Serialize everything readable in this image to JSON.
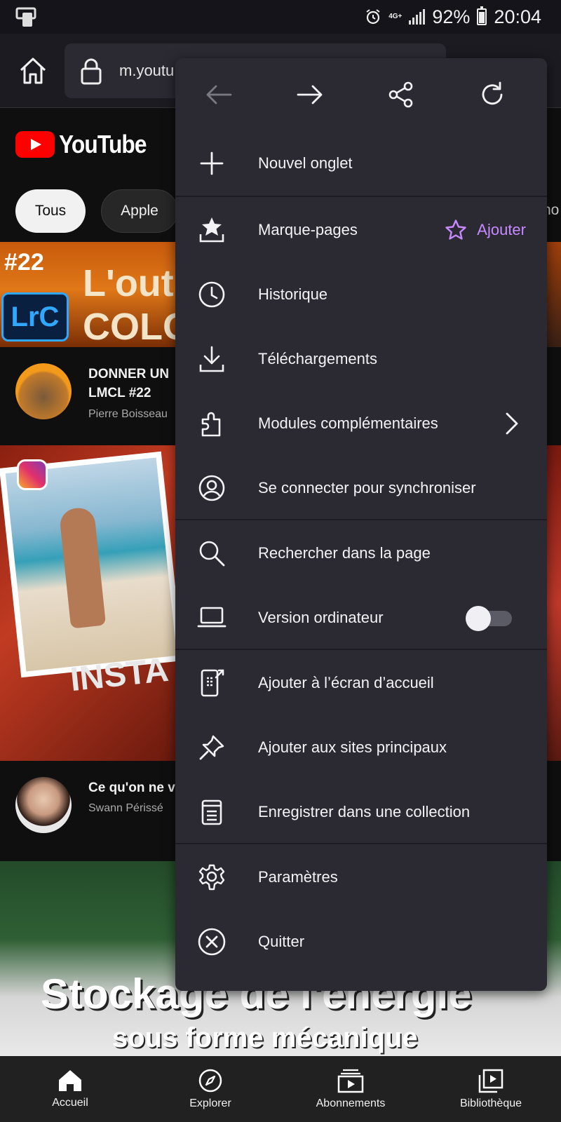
{
  "status_bar": {
    "battery": "92%",
    "time": "20:04",
    "network": "4G+"
  },
  "toolbar": {
    "url": "m.youtu"
  },
  "youtube": {
    "logo_text": "YouTube",
    "chips": [
      "Tous",
      "Apple"
    ],
    "chip_partial": "ho",
    "video1": {
      "thumb_number": "#22",
      "thumb_badge": "LrC",
      "thumb_line1": "L'out",
      "thumb_line2": "COLO",
      "title_line1": "DONNER UN",
      "title_line2": "LMCL #22",
      "channel": "Pierre Boisseau"
    },
    "video2": {
      "thumb_text": "INSTA",
      "title": "Ce qu'on ne v",
      "channel": "Swann Périssé"
    },
    "video3": {
      "line1": "Stockage de l'énergie",
      "line2": "sous forme mécanique"
    }
  },
  "menu": {
    "nav": {
      "back": "arrow-left-icon",
      "forward": "arrow-right-icon",
      "share": "share-icon",
      "reload": "reload-icon"
    },
    "items": [
      {
        "label": "Nouvel onglet",
        "icon": "plus-icon"
      },
      {
        "label": "Marque-pages",
        "icon": "bookmarks-icon",
        "action": "Ajouter"
      },
      {
        "label": "Historique",
        "icon": "clock-icon"
      },
      {
        "label": "Téléchargements",
        "icon": "download-icon"
      },
      {
        "label": "Modules complémentaires",
        "icon": "puzzle-icon"
      },
      {
        "label": "Se connecter pour synchroniser",
        "icon": "account-icon"
      },
      {
        "label": "Rechercher dans la page",
        "icon": "search-icon"
      },
      {
        "label": "Version ordinateur",
        "icon": "laptop-icon",
        "toggle_on": false
      },
      {
        "label": "Ajouter à l’écran d’accueil",
        "icon": "add-to-homescreen-icon"
      },
      {
        "label": "Ajouter aux sites principaux",
        "icon": "pin-icon"
      },
      {
        "label": "Enregistrer dans une collection",
        "icon": "collection-icon"
      },
      {
        "label": "Paramètres",
        "icon": "gear-icon"
      },
      {
        "label": "Quitter",
        "icon": "close-circle-icon"
      }
    ],
    "accent_color": "#c689ff"
  },
  "bottom_nav": [
    {
      "label": "Accueil",
      "icon": "home-icon"
    },
    {
      "label": "Explorer",
      "icon": "compass-icon"
    },
    {
      "label": "Abonnements",
      "icon": "subscriptions-icon"
    },
    {
      "label": "Bibliothèque",
      "icon": "library-icon"
    }
  ]
}
